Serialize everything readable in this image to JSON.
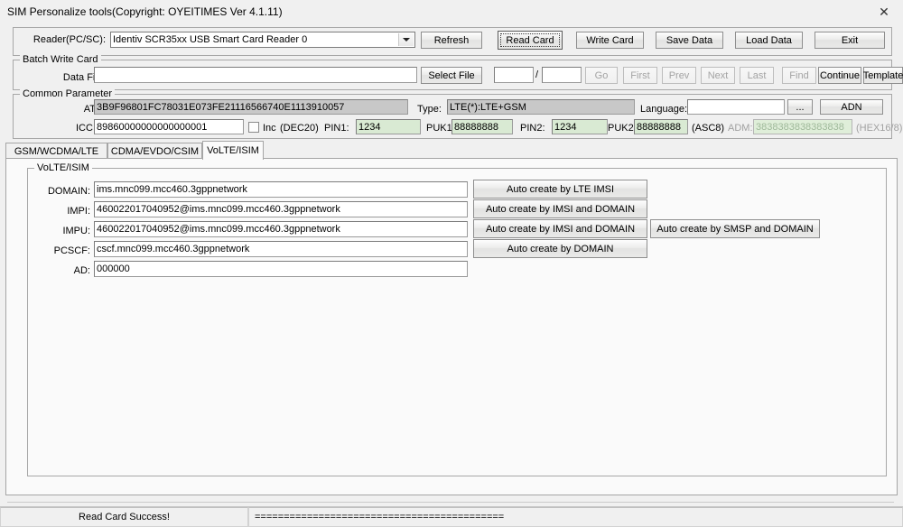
{
  "window": {
    "title": "SIM Personalize tools(Copyright: OYEITIMES Ver 4.1.11)",
    "close_icon": "✕"
  },
  "reader": {
    "label": "Reader(PC/SC):",
    "value": "Identiv SCR35xx USB Smart Card Reader 0",
    "caret_icon": "chevron-down-icon"
  },
  "toolbar": {
    "refresh": "Refresh",
    "read_card": "Read Card",
    "write_card": "Write Card",
    "save_data": "Save Data",
    "load_data": "Load Data",
    "exit": "Exit"
  },
  "batch": {
    "group_title": "Batch Write Card",
    "data_file_label": "Data File:",
    "data_file_value": "",
    "data_file_placeholder": "",
    "select_file": "Select File",
    "index_current": "",
    "index_total": "",
    "slash": "/",
    "go": "Go",
    "first": "First",
    "prev": "Prev",
    "next": "Next",
    "last": "Last",
    "find": "Find",
    "continue": "Continue",
    "template": "Template"
  },
  "common": {
    "group_title": "Common Parameter",
    "atr_label": "ATR:",
    "atr_value": "3B9F96801FC78031E073FE21116566740E1113910057",
    "type_label": "Type:",
    "type_value": "LTE(*):LTE+GSM",
    "language_label": "Language:",
    "language_value": "",
    "ellipsis": "...",
    "adn": "ADN",
    "iccid_label": "ICCID:",
    "iccid_value": "89860000000000000001",
    "inc_label": "Inc",
    "inc_format": "(DEC20)",
    "pin1_label": "PIN1:",
    "pin1_value": "1234",
    "puk1_label": "PUK1:",
    "puk1_value": "88888888",
    "pin2_label": "PIN2:",
    "pin2_value": "1234",
    "puk2_label": "PUK2:",
    "puk2_value": "88888888",
    "asc_note": "(ASC8)",
    "adm_label": "ADM:",
    "adm_value": "3838383838383838",
    "adm_note": "(HEX16/8)"
  },
  "tabs": [
    {
      "label": "GSM/WCDMA/LTE",
      "selected": false
    },
    {
      "label": "CDMA/EVDO/CSIM",
      "selected": false
    },
    {
      "label": "VoLTE/ISIM",
      "selected": true
    }
  ],
  "volte": {
    "group_title": "VoLTE/ISIM",
    "domain_label": "DOMAIN:",
    "domain_value": "ims.mnc099.mcc460.3gppnetwork",
    "impi_label": "IMPI:",
    "impi_value": "460022017040952@ims.mnc099.mcc460.3gppnetwork",
    "impu_label": "IMPU:",
    "impu_value": "460022017040952@ims.mnc099.mcc460.3gppnetwork",
    "pcscf_label": "PCSCF:",
    "pcscf_value": "cscf.mnc099.mcc460.3gppnetwork",
    "ad_label": "AD:",
    "ad_value": "000000",
    "btn_lte_imsi": "Auto create by LTE IMSI",
    "btn_imsi_domain_1": "Auto create by IMSI and DOMAIN",
    "btn_imsi_domain_2": "Auto create by IMSI and DOMAIN",
    "btn_domain": "Auto create by DOMAIN",
    "btn_smsp_domain": "Auto create by SMSP and DOMAIN"
  },
  "status": {
    "message": "Read Card Success!",
    "log": "==========================================="
  },
  "colors": {
    "window_bg": "#f0f0f0",
    "field_green": "#d9ead3",
    "field_readonly": "#c8c8c8",
    "border": "#a7a7a7"
  }
}
